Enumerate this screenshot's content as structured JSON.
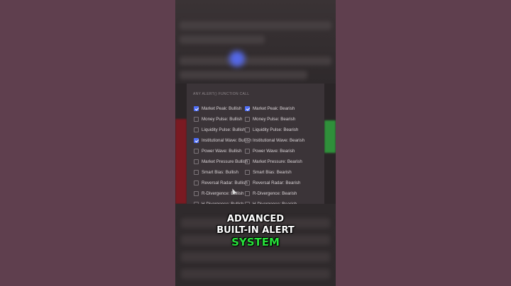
{
  "panel": {
    "header": "ANY ALERT() FUNCTION CALL",
    "rows": [
      {
        "left": {
          "label": "Market Peak: Bullish",
          "checked": true
        },
        "right": {
          "label": "Market Peak: Bearish",
          "checked": true
        }
      },
      {
        "left": {
          "label": "Money Pulse: Bullish",
          "checked": false
        },
        "right": {
          "label": "Money Pulse: Bearish",
          "checked": false
        }
      },
      {
        "left": {
          "label": "Liquidity Pulse: Bullish",
          "checked": false
        },
        "right": {
          "label": "Liquidity Pulse: Bearish",
          "checked": false
        }
      },
      {
        "left": {
          "label": "Institutional Wave: Bullish",
          "checked": true
        },
        "right": {
          "label": "Institutional Wave: Bearish",
          "checked": false
        }
      },
      {
        "left": {
          "label": "Power Wave: Bullish",
          "checked": false
        },
        "right": {
          "label": "Power Wave: Bearish",
          "checked": false
        }
      },
      {
        "left": {
          "label": "Market Pressure Bullish",
          "checked": false
        },
        "right": {
          "label": "Market Pressure: Bearish",
          "checked": false
        }
      },
      {
        "left": {
          "label": "Smart Bias: Bullish",
          "checked": false
        },
        "right": {
          "label": "Smart Bias: Bearish",
          "checked": false
        }
      },
      {
        "left": {
          "label": "Reversal Radar: Bullish",
          "checked": false
        },
        "right": {
          "label": "Reversal Radar: Bearish",
          "checked": false
        }
      },
      {
        "left": {
          "label": "R-Divergence: Bullish",
          "checked": false
        },
        "right": {
          "label": "R-Divergence: Bearish",
          "checked": false
        }
      },
      {
        "left": {
          "label": "H-Divergence: Bullish",
          "checked": false
        },
        "right": {
          "label": "H-Divergence: Bearish",
          "checked": false
        }
      }
    ]
  },
  "caption": {
    "line1": "ADVANCED",
    "line2": "BUILT-IN ALERT",
    "line3": "SYSTEM"
  },
  "colors": {
    "accent": "#4f6ef5",
    "caption_highlight": "#27e03a",
    "background": "#5f3f4e"
  }
}
